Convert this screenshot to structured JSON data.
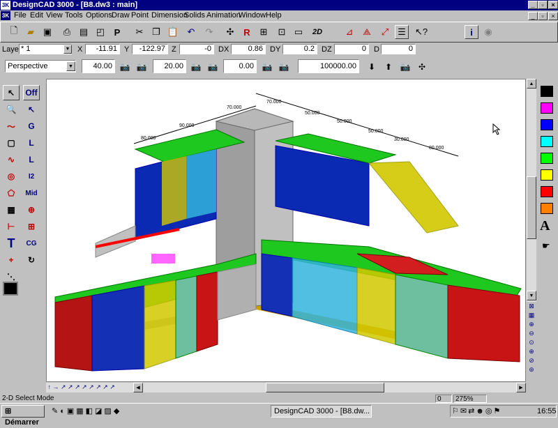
{
  "window": {
    "title": "DesignCAD 3000 - [B8.dw3 : main]",
    "app_badge": "3K"
  },
  "menu": {
    "items": [
      "File",
      "Edit",
      "View",
      "Tools",
      "Options",
      "Draw",
      "Point",
      "Dimension",
      "Solids",
      "Animation",
      "Window",
      "Help"
    ]
  },
  "toolbar": {
    "icons": [
      "new-file-icon",
      "open-folder-icon",
      "save-disk-icon",
      "print-icon",
      "print-preview-icon",
      "page-icon",
      "properties-icon",
      "cut-icon",
      "copy-icon",
      "paste-icon",
      "undo-icon",
      "redo-icon",
      "move-icon",
      "redraw-icon",
      "pan-icon",
      "zoom-window-icon",
      "layer-icon",
      "2d-icon",
      "axis-icon",
      "transform-icon",
      "select-arrow-icon",
      "shade-icon",
      "help-arrow-icon",
      "info-icon",
      "snap-icon"
    ],
    "mode_label": "2D"
  },
  "coords": {
    "layer_label": "Layer",
    "layer_value": "* 1",
    "x_label": "X",
    "x_value": "-11.91",
    "y_label": "Y",
    "y_value": "-122.97",
    "z_label": "Z",
    "z_value": "-0",
    "dx_label": "DX",
    "dx_value": "0.86",
    "dy_label": "DY",
    "dy_value": "0.2",
    "dz_label": "DZ",
    "dz_value": "0",
    "d_label": "D",
    "d_value": "0"
  },
  "view": {
    "mode": "Perspective",
    "angle1": "40.00",
    "angle2": "20.00",
    "angle3": "0.00",
    "distance": "100000.00"
  },
  "lefttools": {
    "off_label": "Off",
    "g_label": "G",
    "l_label": "L",
    "l2_label": "L",
    "i2_label": "I2",
    "mid_label": "Mid",
    "cg_label": "CG",
    "t_label": "T"
  },
  "drawing": {
    "dims_top_left": [
      "80.000",
      "90.000"
    ],
    "dim_column": "70.000",
    "dims_top_right": [
      "70.000",
      "50.000",
      "50.000",
      "50.000",
      "30.000",
      "80.000"
    ]
  },
  "palette": {
    "colors": [
      "#000000",
      "#ff00ff",
      "#0000ff",
      "#00ffff",
      "#00ff00",
      "#ffff00",
      "#ff0000",
      "#ff8000"
    ],
    "text_icon_label": "A"
  },
  "status": {
    "mode_text": "2-D Select Mode",
    "count": "0",
    "zoom": "275%"
  },
  "taskbar": {
    "start_label": "Démarrer",
    "task_label": "DesignCAD 3000 - [B8.dw...",
    "clock": "16:55"
  }
}
